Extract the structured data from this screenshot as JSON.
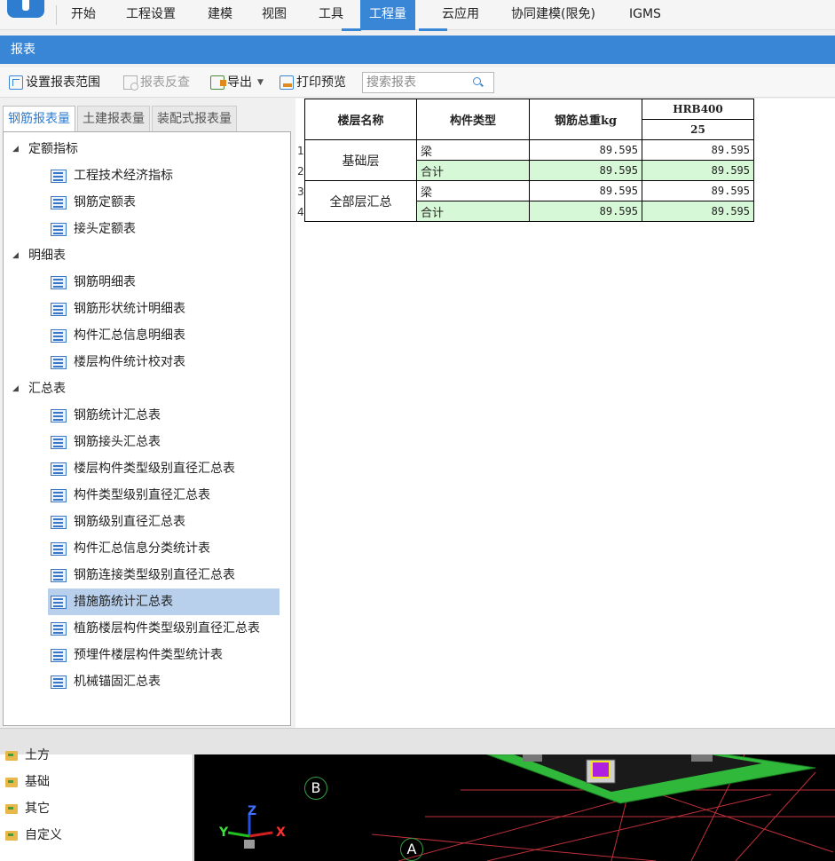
{
  "menubar": {
    "items": [
      "开始",
      "工程设置",
      "建模",
      "视图",
      "工具",
      "工程量",
      "云应用",
      "协同建模(限免)",
      "IGMS"
    ],
    "active_index": 5
  },
  "window": {
    "title": "报表"
  },
  "toolbar": {
    "set_range": "设置报表范围",
    "reverse_check": "报表反查",
    "export": "导出",
    "print_preview": "打印预览",
    "search_placeholder": "搜索报表"
  },
  "tabs": [
    "钢筋报表量",
    "土建报表量",
    "装配式报表量"
  ],
  "tree": {
    "groups": [
      {
        "label": "定额指标",
        "items": [
          "工程技术经济指标",
          "钢筋定额表",
          "接头定额表"
        ]
      },
      {
        "label": "明细表",
        "items": [
          "钢筋明细表",
          "钢筋形状统计明细表",
          "构件汇总信息明细表",
          "楼层构件统计校对表"
        ]
      },
      {
        "label": "汇总表",
        "items": [
          "钢筋统计汇总表",
          "钢筋接头汇总表",
          "楼层构件类型级别直径汇总表",
          "构件类型级别直径汇总表",
          "钢筋级别直径汇总表",
          "构件汇总信息分类统计表",
          "钢筋连接类型级别直径汇总表",
          "措施筋统计汇总表",
          "植筋楼层构件类型级别直径汇总表",
          "预埋件楼层构件类型统计表",
          "机械锚固汇总表"
        ]
      }
    ],
    "selected": "措施筋统计汇总表"
  },
  "report": {
    "headers": {
      "floor": "楼层名称",
      "component": "构件类型",
      "total_weight": "钢筋总重kg",
      "grade": "HRB400",
      "diameter": "25"
    },
    "row_numbers": [
      "1",
      "2",
      "3",
      "4"
    ],
    "groups": [
      {
        "floor": "基础层",
        "rows": [
          {
            "component": "梁",
            "total": "89.595",
            "value": "89.595"
          },
          {
            "component": "合计",
            "total": "89.595",
            "value": "89.595"
          }
        ]
      },
      {
        "floor": "全部层汇总",
        "rows": [
          {
            "component": "梁",
            "total": "89.595",
            "value": "89.595"
          },
          {
            "component": "合计",
            "total": "89.595",
            "value": "89.595"
          }
        ]
      }
    ]
  },
  "bottom_tree": [
    "土方",
    "基础",
    "其它",
    "自定义"
  ],
  "viewport": {
    "axis_labels": [
      "B",
      "A"
    ],
    "gizmo": {
      "x": "X",
      "y": "Y",
      "z": "Z"
    }
  }
}
